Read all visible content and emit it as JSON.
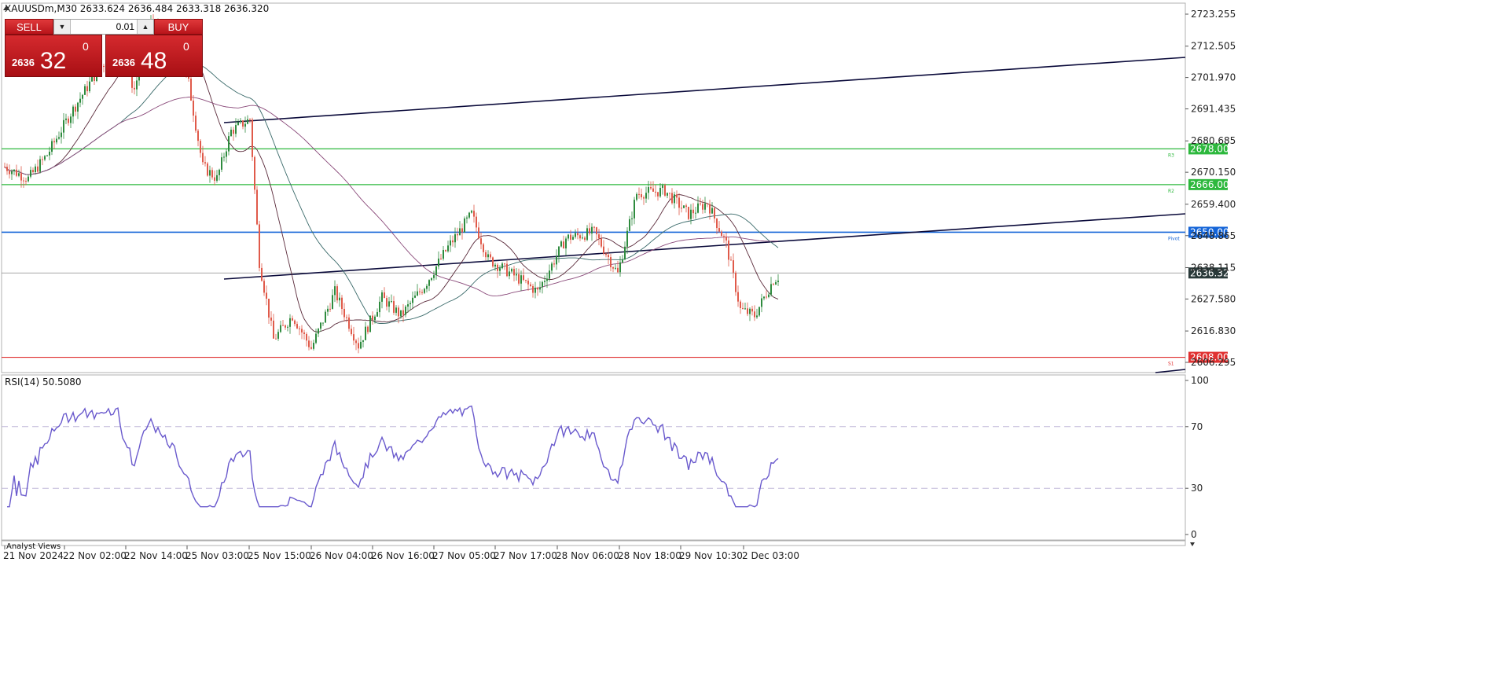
{
  "header": {
    "title": "XAUUSDm,M30  2633.624 2636.484 2633.318 2636.320"
  },
  "trade_panel": {
    "sell_label": "SELL",
    "buy_label": "BUY",
    "volume": "0.01",
    "sell_price_int": "2636",
    "sell_price_big": "32",
    "sell_price_sup": "0",
    "buy_price_int": "2636",
    "buy_price_big": "48",
    "buy_price_sup": "0"
  },
  "price_axis": {
    "ticks": [
      "2723.255",
      "2712.505",
      "2701.970",
      "2691.435",
      "2680.685",
      "2670.150",
      "2659.400",
      "2648.865",
      "2638.115",
      "2627.580",
      "2616.830",
      "2606.295"
    ],
    "tick_values": [
      2723.255,
      2712.505,
      2701.97,
      2691.435,
      2680.685,
      2670.15,
      2659.4,
      2648.865,
      2638.115,
      2627.58,
      2616.83,
      2606.295
    ],
    "current_price": "2636.320",
    "current_value": 2636.32
  },
  "levels": [
    {
      "value": 2678.0,
      "label": "2678.000",
      "color": "#2db83d",
      "name": "R3"
    },
    {
      "value": 2666.0,
      "label": "2666.000",
      "color": "#2db83d",
      "name": "R2"
    },
    {
      "value": 2650.0,
      "label": "2650.000",
      "color": "#1565d8",
      "name": "Pivot"
    },
    {
      "value": 2608.0,
      "label": "2608.000",
      "color": "#e03030",
      "name": "S1"
    }
  ],
  "time_axis": {
    "labels": [
      "21 Nov 2024",
      "22 Nov 02:00",
      "22 Nov 14:00",
      "25 Nov 03:00",
      "25 Nov 15:00",
      "26 Nov 04:00",
      "26 Nov 16:00",
      "27 Nov 05:00",
      "27 Nov 17:00",
      "28 Nov 06:00",
      "28 Nov 18:00",
      "29 Nov 10:30",
      "2 Dec 03:00"
    ]
  },
  "rsi": {
    "label": "RSI(14) 50.5080",
    "levels": [
      "100",
      "70",
      "30",
      "0"
    ],
    "color": "#6a5acd"
  },
  "subwindow_label": "Analyst Views",
  "colors": {
    "bull": "#2e8b3e",
    "bear": "#e05a4a",
    "ma_fast": "#5a2a3a",
    "ma_mid": "#3a6a6a",
    "ma_slow": "#8a4a7a",
    "channel": "#0a0a3a"
  },
  "chart_data": {
    "type": "candlestick",
    "series_anchors": {
      "x": [
        "21 Nov 2024",
        "22 Nov 02:00",
        "22 Nov 14:00",
        "25 Nov 03:00",
        "25 Nov 15:00",
        "26 Nov 04:00",
        "26 Nov 16:00",
        "27 Nov 05:00",
        "27 Nov 17:00",
        "28 Nov 06:00",
        "28 Nov 18:00",
        "29 Nov 10:30",
        "2 Dec 03:00"
      ],
      "approx_close": [
        2672,
        2690,
        2710,
        2676,
        2627,
        2622,
        2630,
        2653,
        2629,
        2643,
        2663,
        2658,
        2636
      ]
    },
    "rsi_anchors": [
      56,
      82,
      74,
      26,
      24,
      52,
      55,
      75,
      44,
      66,
      74,
      50,
      50.5
    ],
    "ylim": [
      2600,
      2726
    ]
  }
}
